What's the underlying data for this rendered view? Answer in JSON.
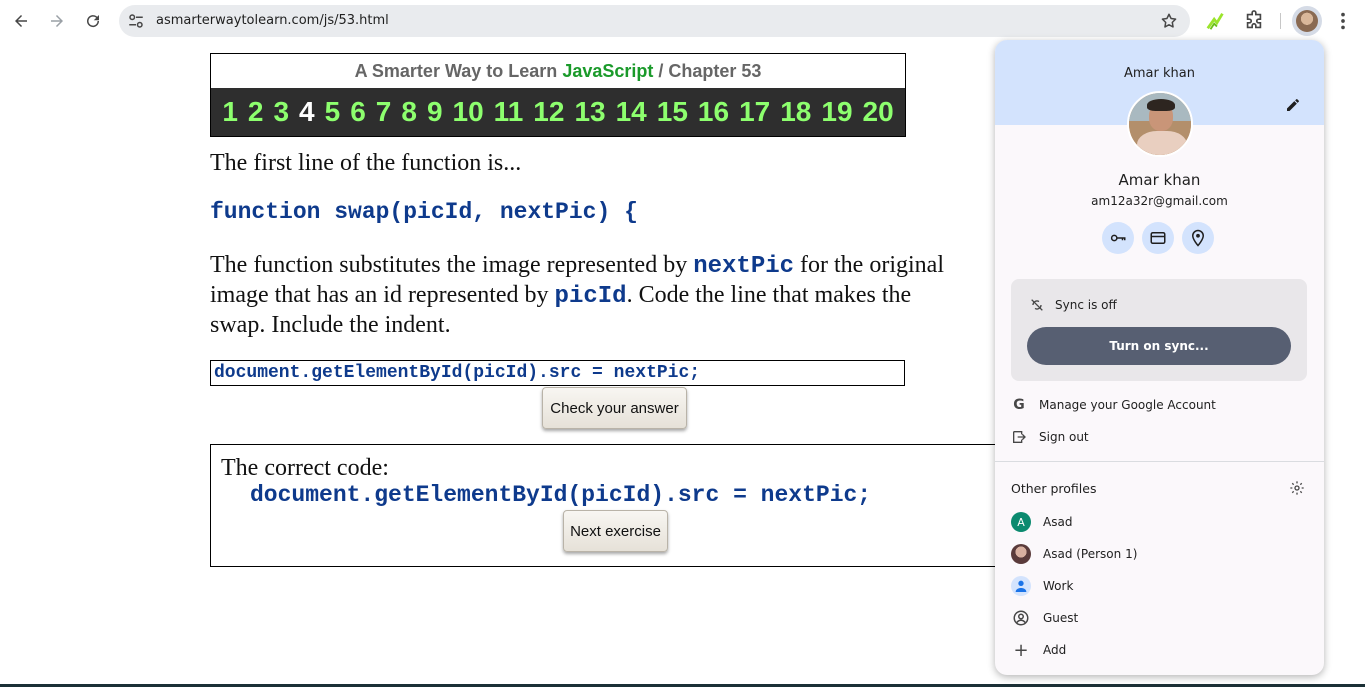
{
  "browser": {
    "url": "asmarterwaytolearn.com/js/53.html"
  },
  "header": {
    "title_prefix": "A Smarter Way to Learn ",
    "title_js": "JavaScript",
    "title_suffix": " / Chapter 53",
    "chapters": [
      "1",
      "2",
      "3",
      "4",
      "5",
      "6",
      "7",
      "8",
      "9",
      "10",
      "11",
      "12",
      "13",
      "14",
      "15",
      "16",
      "17",
      "18",
      "19",
      "20"
    ],
    "current_chapter": "4"
  },
  "lesson": {
    "line1": "The first line of the function is...",
    "code1": "function swap(picId, nextPic) {",
    "para_a": "The function substitutes the image represented by ",
    "para_code_a": "nextPic",
    "para_b": " for the original",
    "para_c": "image that has an id represented by ",
    "para_code_b": "picId",
    "para_d": ". Code the line that makes the",
    "para_e": "swap. Include the indent.",
    "answer_value": "document.getElementById(picId).src = nextPic;",
    "check_button": "Check your answer",
    "correct_label": "The correct code:",
    "correct_code": "document.getElementById(picId).src = nextPic;",
    "next_button": "Next exercise"
  },
  "profile_panel": {
    "name_top": "Amar khan",
    "name": "Amar khan",
    "email": "am12a32r@gmail.com",
    "sync_status": "Sync is off",
    "sync_button": "Turn on sync...",
    "menu": [
      "Manage your Google Account",
      "Sign out"
    ],
    "other_profiles_title": "Other profiles",
    "profiles": [
      {
        "label": "Asad",
        "initial": "A",
        "color": "#0b8a6f"
      },
      {
        "label": "Asad (Person 1)",
        "initial": "",
        "color": "#6b4a4a"
      },
      {
        "label": "Work",
        "initial": "",
        "color": "#d3e3fd"
      },
      {
        "label": "Guest",
        "initial": "",
        "color": "#fbf8fb"
      },
      {
        "label": "Add",
        "initial": "",
        "color": "#fbf8fb"
      }
    ]
  }
}
